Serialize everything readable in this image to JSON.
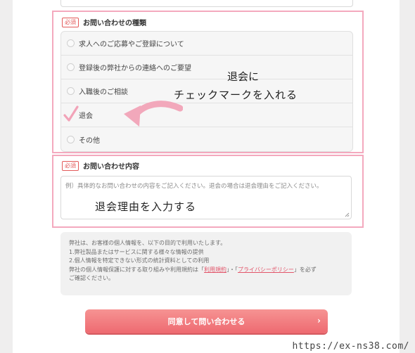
{
  "form": {
    "inquiry_type": {
      "required_badge": "必須",
      "title": "お問い合わせの種類",
      "options": [
        {
          "label": "求人へのご応募やご登録について",
          "checked": false
        },
        {
          "label": "登録後の弊社からの連絡へのご要望",
          "checked": false
        },
        {
          "label": "入職後のご相談",
          "checked": false
        },
        {
          "label": "退会",
          "checked": true
        },
        {
          "label": "その他",
          "checked": false
        }
      ]
    },
    "inquiry_content": {
      "required_badge": "必須",
      "title": "お問い合わせ内容",
      "placeholder": "例）具体的なお問い合わせの内容をご記入ください。退会の場合は退会理由をご記入ください。"
    },
    "privacy": {
      "line1": "弊社は、お客様の個人情報を、以下の目的で利用いたします。",
      "line2": "1.弊社製品またはサービスに関する様々な情報の提供",
      "line3": "2.個人情報を特定できない形式の統計資料としての利用",
      "line4_pre": "弊社の個人情報保護に対する取り組みや利用規約は「",
      "link_terms": "利用規約",
      "line4_mid": "」・「",
      "link_policy": "プライバシーポリシー",
      "line4_post": "」を必ず",
      "line5": "ご確認ください。"
    },
    "submit_label": "同意して問い合わせる",
    "submit_arrow": "›"
  },
  "annotations": {
    "note_top_line1": "退会に",
    "note_top_line2": "チェックマークを入れる",
    "note_textarea": "退会理由を入力する",
    "highlight_color": "#f4a9be"
  },
  "watermark": "https://ex-ns38.com/"
}
